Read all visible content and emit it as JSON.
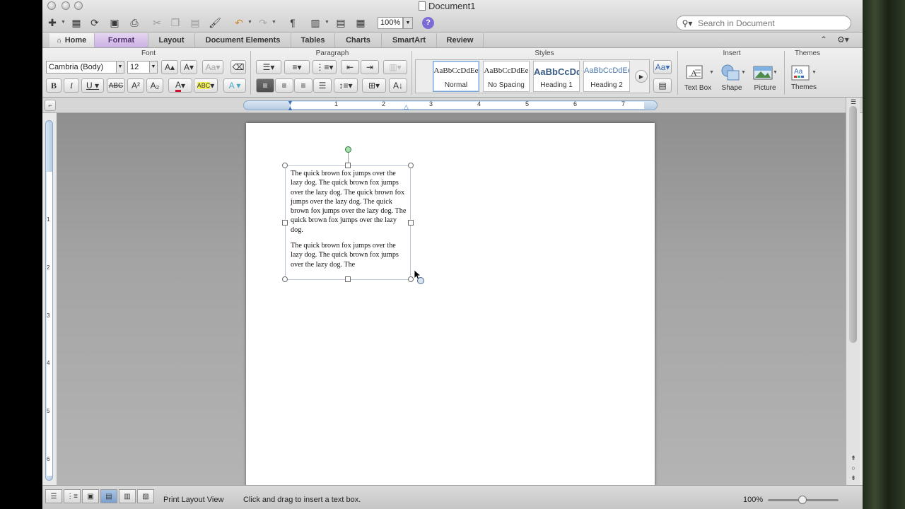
{
  "window": {
    "title": "Document1"
  },
  "toolbar": {
    "zoom": "100%",
    "help_label": "?"
  },
  "search": {
    "placeholder": "Search in Document"
  },
  "tabs": [
    {
      "label": "Home"
    },
    {
      "label": "Format"
    },
    {
      "label": "Layout"
    },
    {
      "label": "Document Elements"
    },
    {
      "label": "Tables"
    },
    {
      "label": "Charts"
    },
    {
      "label": "SmartArt"
    },
    {
      "label": "Review"
    }
  ],
  "ribbon": {
    "font_group": "Font",
    "paragraph_group": "Paragraph",
    "styles_group": "Styles",
    "insert_group": "Insert",
    "themes_group": "Themes",
    "font_name": "Cambria (Body)",
    "font_size": "12",
    "styles": [
      {
        "sample": "AaBbCcDdEe",
        "label": "Normal"
      },
      {
        "sample": "AaBbCcDdEe",
        "label": "No Spacing"
      },
      {
        "sample": "AaBbCcDd",
        "label": "Heading 1"
      },
      {
        "sample": "AaBbCcDdEe",
        "label": "Heading 2"
      }
    ],
    "insert_items": [
      {
        "label": "Text Box",
        "icon": "text-box-icon"
      },
      {
        "label": "Shape",
        "icon": "shape-icon"
      },
      {
        "label": "Picture",
        "icon": "picture-icon"
      }
    ],
    "themes_label": "Themes"
  },
  "ruler": {
    "numbers": [
      "1",
      "2",
      "3",
      "4",
      "5",
      "6",
      "7"
    ]
  },
  "vruler": {
    "numbers": [
      "1",
      "2",
      "3",
      "4",
      "5",
      "6"
    ]
  },
  "document": {
    "paragraphs": [
      "The quick brown fox jumps over the lazy dog.  The quick brown fox jumps over the lazy dog.  The quick brown fox jumps over the lazy dog.  The quick brown fox jumps over the lazy dog.  The quick brown fox jumps over the lazy dog.",
      "The quick brown fox jumps over the lazy dog.  The quick brown fox jumps over the lazy dog.  The"
    ]
  },
  "status": {
    "view_name": "Print Layout View",
    "message": "Click and drag to insert a text box.",
    "zoom": "100%"
  },
  "colors": {
    "format_tab": "#cbb1e3",
    "accent": "#7b6bd6",
    "selection": "#7ba0ce"
  }
}
